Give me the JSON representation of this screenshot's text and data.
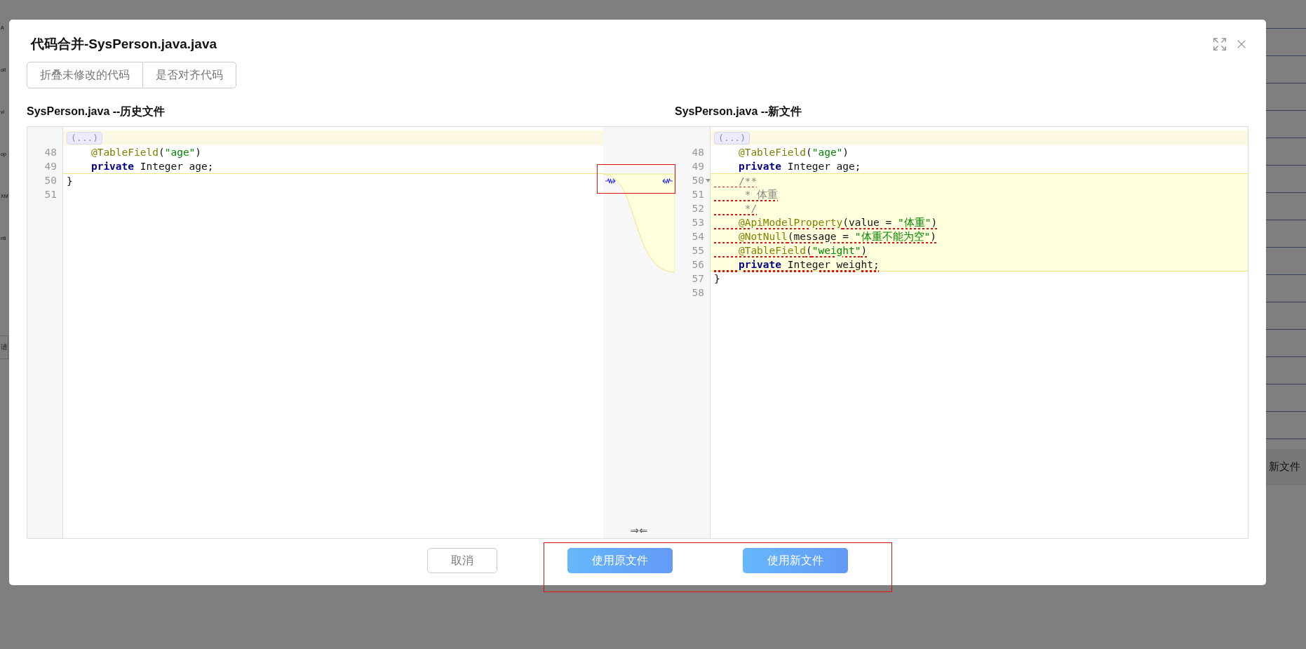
{
  "background": {
    "left_labels": [
      "A",
      "oll",
      "vi",
      "op",
      "XM",
      "nti"
    ],
    "field_placeholder": "请",
    "right_label": "新文件"
  },
  "dialog": {
    "title": "代码合并-SysPerson.java.java",
    "toolbar": [
      {
        "label": "折叠未修改的代码"
      },
      {
        "label": "是否对齐代码"
      }
    ],
    "left_pane": {
      "title": "SysPerson.java --历史文件",
      "fold_marker": "(...)",
      "lines": [
        {
          "number": "48",
          "gap_above": false,
          "changed": false,
          "foldable": false,
          "tokens": [
            {
              "kind": "annotation",
              "text": "    @TableField"
            },
            {
              "kind": "plain",
              "text": "("
            },
            {
              "kind": "string",
              "text": "\"age\""
            },
            {
              "kind": "plain",
              "text": ")"
            }
          ]
        },
        {
          "number": "49",
          "gap_above": false,
          "changed": false,
          "foldable": false,
          "tokens": [
            {
              "kind": "keyword",
              "text": "    private"
            },
            {
              "kind": "plain",
              "text": " Integer age;"
            }
          ]
        },
        {
          "number": "50",
          "gap_above": true,
          "changed": false,
          "foldable": false,
          "tokens": [
            {
              "kind": "plain",
              "text": "}"
            }
          ]
        },
        {
          "number": "51",
          "gap_above": false,
          "changed": false,
          "foldable": false
        }
      ]
    },
    "merge_gutter": {
      "collapse_label": "⇒⇐"
    },
    "right_pane": {
      "title": "SysPerson.java --新文件",
      "fold_marker": "(...)",
      "lines": [
        {
          "number": "48",
          "gap_above": false,
          "changed": false,
          "foldable": false,
          "tokens": [
            {
              "kind": "annotation",
              "text": "    @TableField"
            },
            {
              "kind": "plain",
              "text": "("
            },
            {
              "kind": "string",
              "text": "\"age\""
            },
            {
              "kind": "plain",
              "text": ")"
            }
          ]
        },
        {
          "number": "49",
          "gap_above": false,
          "changed": false,
          "foldable": false,
          "tokens": [
            {
              "kind": "keyword",
              "text": "    private"
            },
            {
              "kind": "plain",
              "text": " Integer age;"
            }
          ]
        },
        {
          "number": "50",
          "gap_above": false,
          "changed": true,
          "foldable": true,
          "tokens": [
            {
              "kind": "comment",
              "text": "    /**"
            }
          ]
        },
        {
          "number": "51",
          "gap_above": false,
          "changed": true,
          "foldable": false,
          "tokens": [
            {
              "kind": "comment",
              "text": "     * 体重"
            }
          ]
        },
        {
          "number": "52",
          "gap_above": false,
          "changed": true,
          "foldable": false,
          "tokens": [
            {
              "kind": "comment",
              "text": "     */"
            }
          ]
        },
        {
          "number": "53",
          "gap_above": false,
          "changed": true,
          "foldable": false,
          "tokens": [
            {
              "kind": "annotation",
              "text": "    @ApiModelProperty"
            },
            {
              "kind": "plain",
              "text": "(value = "
            },
            {
              "kind": "string",
              "text": "\"体重\""
            },
            {
              "kind": "plain",
              "text": ")"
            }
          ]
        },
        {
          "number": "54",
          "gap_above": false,
          "changed": true,
          "foldable": false,
          "tokens": [
            {
              "kind": "annotation",
              "text": "    @NotNull"
            },
            {
              "kind": "plain",
              "text": "(message = "
            },
            {
              "kind": "string",
              "text": "\"体重不能为空\""
            },
            {
              "kind": "plain",
              "text": ")"
            }
          ]
        },
        {
          "number": "55",
          "gap_above": false,
          "changed": true,
          "foldable": false,
          "tokens": [
            {
              "kind": "annotation",
              "text": "    @TableField"
            },
            {
              "kind": "plain",
              "text": "("
            },
            {
              "kind": "string",
              "text": "\"weight\""
            },
            {
              "kind": "plain",
              "text": ")"
            }
          ]
        },
        {
          "number": "56",
          "gap_above": false,
          "changed": true,
          "foldable": false,
          "tokens": [
            {
              "kind": "keyword",
              "text": "    private"
            },
            {
              "kind": "plain",
              "text": " Integer weight;"
            }
          ]
        },
        {
          "number": "57",
          "gap_above": false,
          "changed": false,
          "foldable": false,
          "tokens": [
            {
              "kind": "plain",
              "text": "}"
            }
          ]
        },
        {
          "number": "58",
          "gap_above": false,
          "changed": false,
          "foldable": false
        }
      ]
    },
    "footer": [
      {
        "kind": "plain",
        "label": "取消"
      },
      {
        "kind": "primary",
        "label": "使用原文件"
      },
      {
        "kind": "primary",
        "label": "使用新文件"
      }
    ]
  }
}
